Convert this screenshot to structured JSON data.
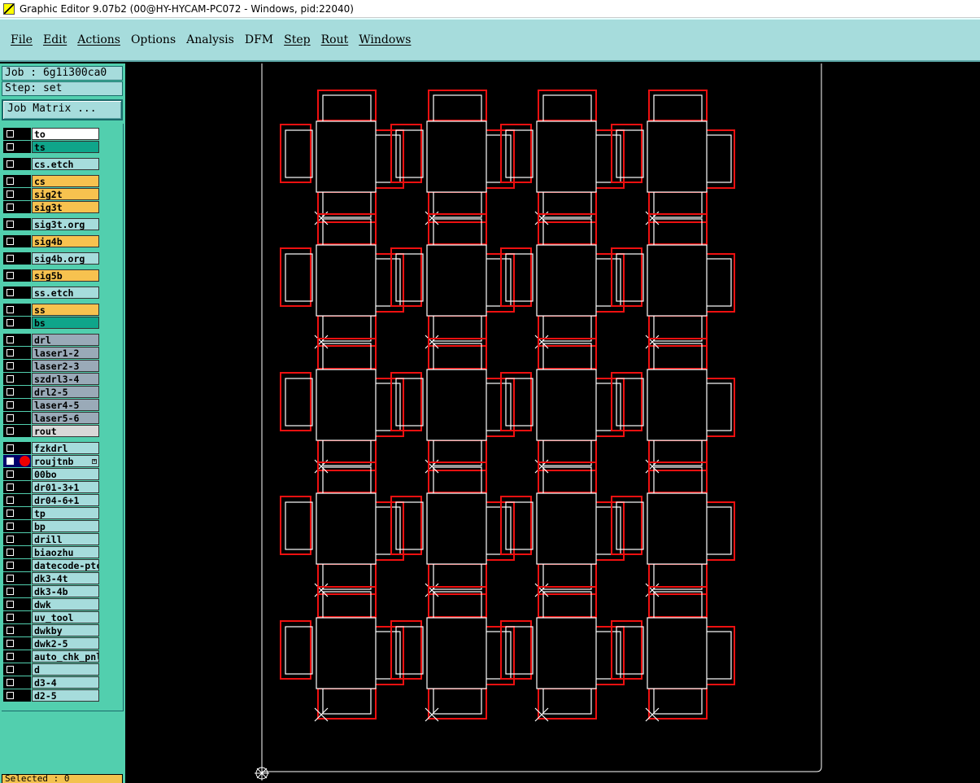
{
  "window": {
    "title": "Graphic Editor 9.07b2 (00@HY-HYCAM-PC072 - Windows, pid:22040)"
  },
  "menu": [
    "File",
    "Edit",
    "Actions",
    "Options",
    "Analysis",
    "DFM",
    "Step",
    "Rout",
    "Windows"
  ],
  "job": {
    "label": "Job : 6g1i300ca0",
    "step": "Step: set"
  },
  "job_matrix_label": "Job Matrix ...",
  "status": "Selected : 0",
  "colors": {
    "white": "#ffffff",
    "signal": "#0fa58a",
    "etch": "#a6dcdc",
    "orange": "#f7c24f",
    "drill": "#9aaab8",
    "rout": "#d8d8d8",
    "red": "#ee1010"
  },
  "layers": [
    {
      "name": "to",
      "color": "white"
    },
    {
      "name": "ts",
      "color": "signal"
    },
    {
      "name": "cs.etch",
      "color": "etch"
    },
    {
      "name": "cs",
      "color": "orange"
    },
    {
      "name": "sig2t",
      "color": "orange"
    },
    {
      "name": "sig3t",
      "color": "orange"
    },
    {
      "name": "sig3t.org",
      "color": "etch"
    },
    {
      "name": "sig4b",
      "color": "orange"
    },
    {
      "name": "sig4b.org",
      "color": "etch"
    },
    {
      "name": "sig5b",
      "color": "orange"
    },
    {
      "name": "ss.etch",
      "color": "etch"
    },
    {
      "name": "ss",
      "color": "orange"
    },
    {
      "name": "bs",
      "color": "signal"
    },
    {
      "name": "drl",
      "color": "drill"
    },
    {
      "name": "laser1-2",
      "color": "drill"
    },
    {
      "name": "laser2-3",
      "color": "drill"
    },
    {
      "name": "szdrl3-4",
      "color": "drill"
    },
    {
      "name": "drl2-5",
      "color": "drill"
    },
    {
      "name": "laser4-5",
      "color": "drill"
    },
    {
      "name": "laser5-6",
      "color": "drill"
    },
    {
      "name": "rout",
      "color": "rout"
    },
    {
      "name": "fzkdrl",
      "color": "etch"
    },
    {
      "name": "roujtnb",
      "color": "etch",
      "active": true
    },
    {
      "name": "00bo",
      "color": "etch"
    },
    {
      "name": "dr01-3+1",
      "color": "etch"
    },
    {
      "name": "dr04-6+1",
      "color": "etch"
    },
    {
      "name": "tp",
      "color": "etch"
    },
    {
      "name": "bp",
      "color": "etch"
    },
    {
      "name": "drill",
      "color": "etch"
    },
    {
      "name": "biaozhu",
      "color": "etch"
    },
    {
      "name": "datecode-ptc",
      "color": "etch"
    },
    {
      "name": "dk3-4t",
      "color": "etch"
    },
    {
      "name": "dk3-4b",
      "color": "etch"
    },
    {
      "name": "dwk",
      "color": "etch"
    },
    {
      "name": "uv_tool",
      "color": "etch"
    },
    {
      "name": "dwkby",
      "color": "etch"
    },
    {
      "name": "dwk2-5",
      "color": "etch"
    },
    {
      "name": "auto_chk_pnl",
      "color": "etch"
    },
    {
      "name": "d",
      "color": "etch"
    },
    {
      "name": "d3-4",
      "color": "etch"
    },
    {
      "name": "d2-5",
      "color": "etch"
    }
  ],
  "board": {
    "columns": 4,
    "rows": 5
  }
}
